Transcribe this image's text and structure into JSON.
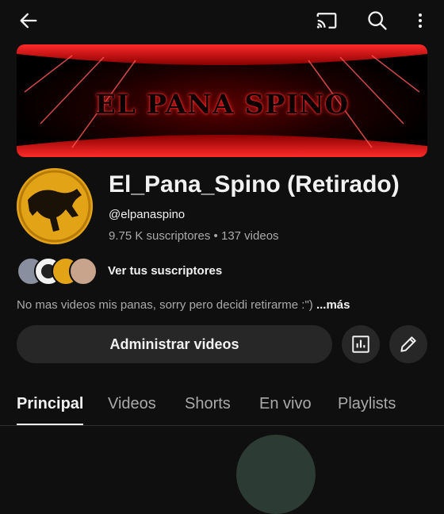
{
  "topbar": {
    "back_icon": "arrow-left-icon",
    "cast_icon": "cast-icon",
    "search_icon": "search-icon",
    "more_icon": "more-vert-icon"
  },
  "banner": {
    "text": "EL PANA SPINO"
  },
  "channel": {
    "name": "El_Pana_Spino (Retirado)",
    "handle": "@elpanaspino",
    "stats": "9.75 K suscriptores • 137 videos"
  },
  "subscribers": {
    "link_label": "Ver tus suscriptores"
  },
  "description": {
    "text": "No mas videos mis panas, sorry pero decidi retirarme :\") ",
    "more_label": "...más"
  },
  "actions": {
    "manage_label": "Administrar videos",
    "analytics_icon": "analytics-icon",
    "edit_icon": "pencil-icon"
  },
  "tabs": [
    {
      "label": "Principal",
      "active": true
    },
    {
      "label": "Videos",
      "active": false
    },
    {
      "label": "Shorts",
      "active": false
    },
    {
      "label": "En vivo",
      "active": false
    },
    {
      "label": "Playlists",
      "active": false
    }
  ],
  "colors": {
    "background": "#0f0f0f",
    "button_bg": "#272727",
    "text_primary": "#f1f1f1",
    "text_secondary": "#aaaaaa",
    "banner_red": "#e01010",
    "avatar_yellow": "#e3a317"
  }
}
